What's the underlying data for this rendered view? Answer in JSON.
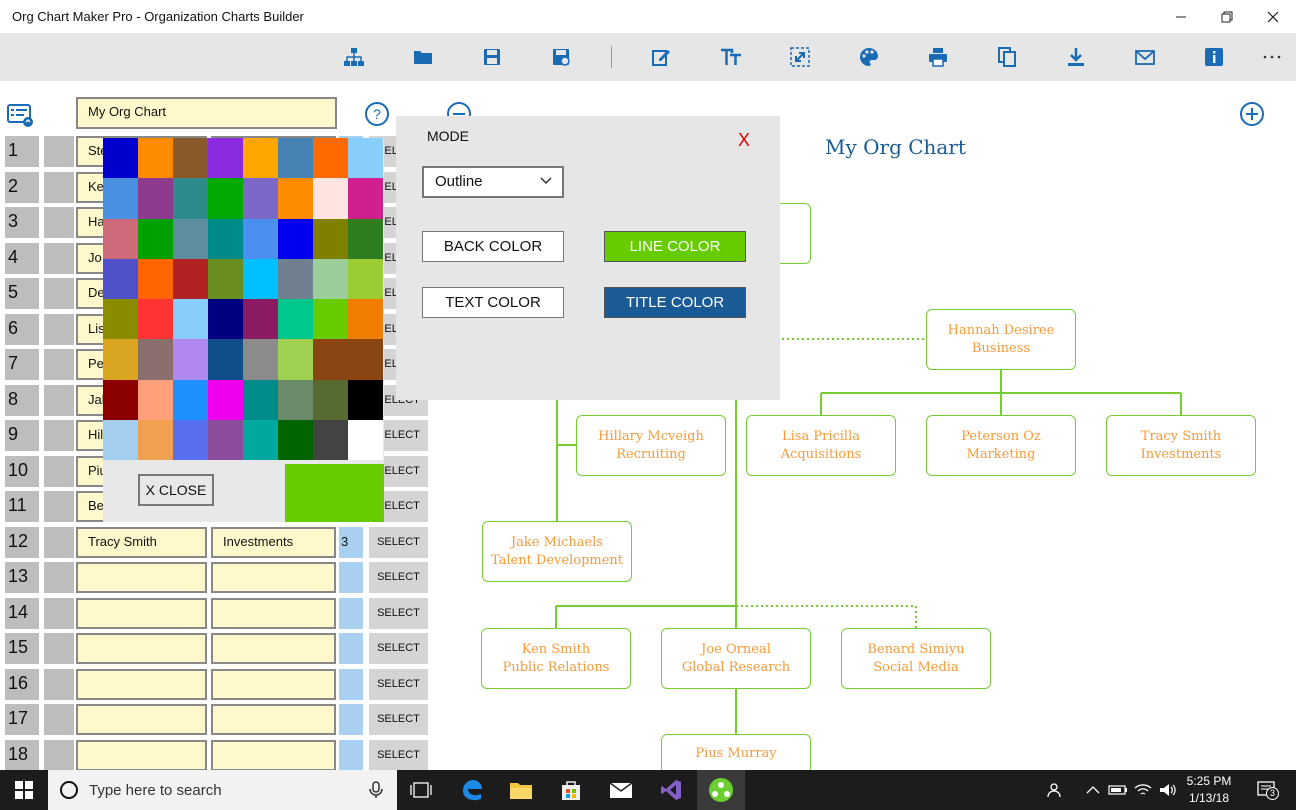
{
  "window": {
    "title": "Org Chart Maker Pro - Organization Charts Builder"
  },
  "left_panel": {
    "chart_title_value": "My Org Chart",
    "select_label": "SELECT",
    "rows": [
      {
        "num": "1",
        "name": "Ste",
        "title": "",
        "level": ""
      },
      {
        "num": "2",
        "name": "Ke",
        "title": "",
        "level": ""
      },
      {
        "num": "3",
        "name": "Ha",
        "title": "",
        "level": ""
      },
      {
        "num": "4",
        "name": "Jo",
        "title": "",
        "level": ""
      },
      {
        "num": "5",
        "name": "De",
        "title": "",
        "level": ""
      },
      {
        "num": "6",
        "name": "Lis",
        "title": "",
        "level": ""
      },
      {
        "num": "7",
        "name": "Pe",
        "title": "",
        "level": ""
      },
      {
        "num": "8",
        "name": "Jal",
        "title": "",
        "level": ""
      },
      {
        "num": "9",
        "name": "Hil",
        "title": "",
        "level": ""
      },
      {
        "num": "10",
        "name": "Piu",
        "title": "",
        "level": ""
      },
      {
        "num": "11",
        "name": "Be",
        "title": "",
        "level": ""
      },
      {
        "num": "12",
        "name": "Tracy Smith",
        "title": "Investments",
        "level": "3"
      },
      {
        "num": "13",
        "name": "",
        "title": "",
        "level": ""
      },
      {
        "num": "14",
        "name": "",
        "title": "",
        "level": ""
      },
      {
        "num": "15",
        "name": "",
        "title": "",
        "level": ""
      },
      {
        "num": "16",
        "name": "",
        "title": "",
        "level": ""
      },
      {
        "num": "17",
        "name": "",
        "title": "",
        "level": ""
      },
      {
        "num": "18",
        "name": "",
        "title": "",
        "level": ""
      }
    ]
  },
  "palette": {
    "close_label": "X CLOSE",
    "selected_color": "#66cc00",
    "colors": [
      "#0000cd",
      "#ff8c00",
      "#8b5a2b",
      "#8a2be2",
      "#ffa500",
      "#4682b4",
      "#ff6a00",
      "#87cefa",
      "#4a90e2",
      "#8e3a8e",
      "#2e8b8b",
      "#00aa00",
      "#7b68c8",
      "#ff8c00",
      "#ffe4e1",
      "#d02090",
      "#cd6a7a",
      "#00a000",
      "#5f8da0",
      "#008b8b",
      "#4a90f0",
      "#0000ee",
      "#808000",
      "#2e7d1e",
      "#5050c8",
      "#ff6600",
      "#b22222",
      "#6b8e23",
      "#00bfff",
      "#708090",
      "#9acd9a",
      "#9acd32",
      "#8b8b00",
      "#ff3333",
      "#87cefa",
      "#000080",
      "#8b1c62",
      "#00c88c",
      "#66cc00",
      "#f07d00",
      "#daa520",
      "#8b6e6e",
      "#b088f0",
      "#104e8b",
      "#8b8b8b",
      "#a0d050",
      "#8b4513",
      "#8b4513",
      "#8b0000",
      "#ffa07a",
      "#1e90ff",
      "#ee00ee",
      "#008b8b",
      "#6b8b6b",
      "#556b2f",
      "#000000",
      "#a4cfee",
      "#f0a050",
      "#5a6ef0",
      "#8b4c9b",
      "#00a8a0",
      "#006400",
      "#444444",
      "#ffffff"
    ]
  },
  "mode_dialog": {
    "label": "MODE",
    "close": "X",
    "mode_value": "Outline",
    "back_color": "BACK COLOR",
    "line_color": "LINE COLOR",
    "text_color": "TEXT COLOR",
    "title_color": "TITLE COLOR",
    "line_color_hex": "#66cc00",
    "title_color_hex": "#1a5b96"
  },
  "chart": {
    "title": "My Org Chart",
    "nodes": {
      "hannah": {
        "name": "Hannah Desiree",
        "role": "Business"
      },
      "hillary": {
        "name": "Hillary Mcveigh",
        "role": "Recruiting"
      },
      "lisa": {
        "name": "Lisa Pricilla",
        "role": "Acquisitions"
      },
      "peterson": {
        "name": "Peterson Oz",
        "role": "Marketing"
      },
      "tracy": {
        "name": "Tracy Smith",
        "role": "Investments"
      },
      "jake": {
        "name": "Jake Michaels",
        "role": "Talent Development"
      },
      "ken": {
        "name": "Ken Smith",
        "role": "Public Relations"
      },
      "joe": {
        "name": "Joe Orneal",
        "role": "Global Research"
      },
      "benard": {
        "name": "Benard Simiyu",
        "role": "Social Media"
      },
      "pius": {
        "name": "Pius Murray",
        "role": ""
      }
    }
  },
  "taskbar": {
    "search_placeholder": "Type here to search",
    "time": "5:25 PM",
    "date": "1/13/18",
    "notification_count": "3"
  }
}
